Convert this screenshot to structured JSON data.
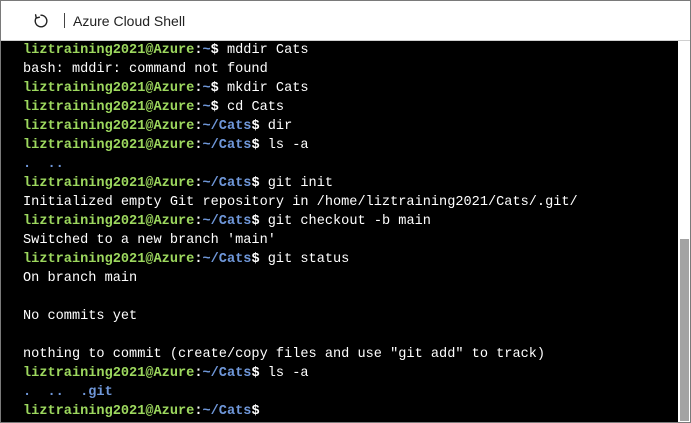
{
  "window": {
    "title": "Azure Cloud Shell",
    "refresh_icon": "refresh-icon"
  },
  "prompt": {
    "user_host": "liztraining2021@Azure",
    "home_path": "~",
    "cats_path": "~/Cats",
    "dollar": "$"
  },
  "terminal": {
    "lines": [
      {
        "type": "prompt",
        "path": "~",
        "cmd": " mddir Cats"
      },
      {
        "type": "output",
        "text": "bash: mddir: command not found"
      },
      {
        "type": "prompt",
        "path": "~",
        "cmd": " mkdir Cats"
      },
      {
        "type": "prompt",
        "path": "~",
        "cmd": " cd Cats"
      },
      {
        "type": "prompt",
        "path": "~/Cats",
        "cmd": " dir"
      },
      {
        "type": "prompt",
        "path": "~/Cats",
        "cmd": " ls -a"
      },
      {
        "type": "dirlist",
        "text": ".  .."
      },
      {
        "type": "prompt",
        "path": "~/Cats",
        "cmd": " git init"
      },
      {
        "type": "output",
        "text": "Initialized empty Git repository in /home/liztraining2021/Cats/.git/"
      },
      {
        "type": "prompt",
        "path": "~/Cats",
        "cmd": " git checkout -b main"
      },
      {
        "type": "output",
        "text": "Switched to a new branch 'main'"
      },
      {
        "type": "prompt",
        "path": "~/Cats",
        "cmd": " git status"
      },
      {
        "type": "output",
        "text": "On branch main"
      },
      {
        "type": "output",
        "text": ""
      },
      {
        "type": "output",
        "text": "No commits yet"
      },
      {
        "type": "output",
        "text": ""
      },
      {
        "type": "output",
        "text": "nothing to commit (create/copy files and use \"git add\" to track)"
      },
      {
        "type": "prompt",
        "path": "~/Cats",
        "cmd": " ls -a"
      },
      {
        "type": "dirlist",
        "text": ".  ..  .git"
      },
      {
        "type": "prompt",
        "path": "~/Cats",
        "cmd": ""
      }
    ]
  },
  "colors": {
    "background": "#000000",
    "user_host": "#9dd85e",
    "path": "#6f97d9",
    "text": "#ffffff"
  }
}
